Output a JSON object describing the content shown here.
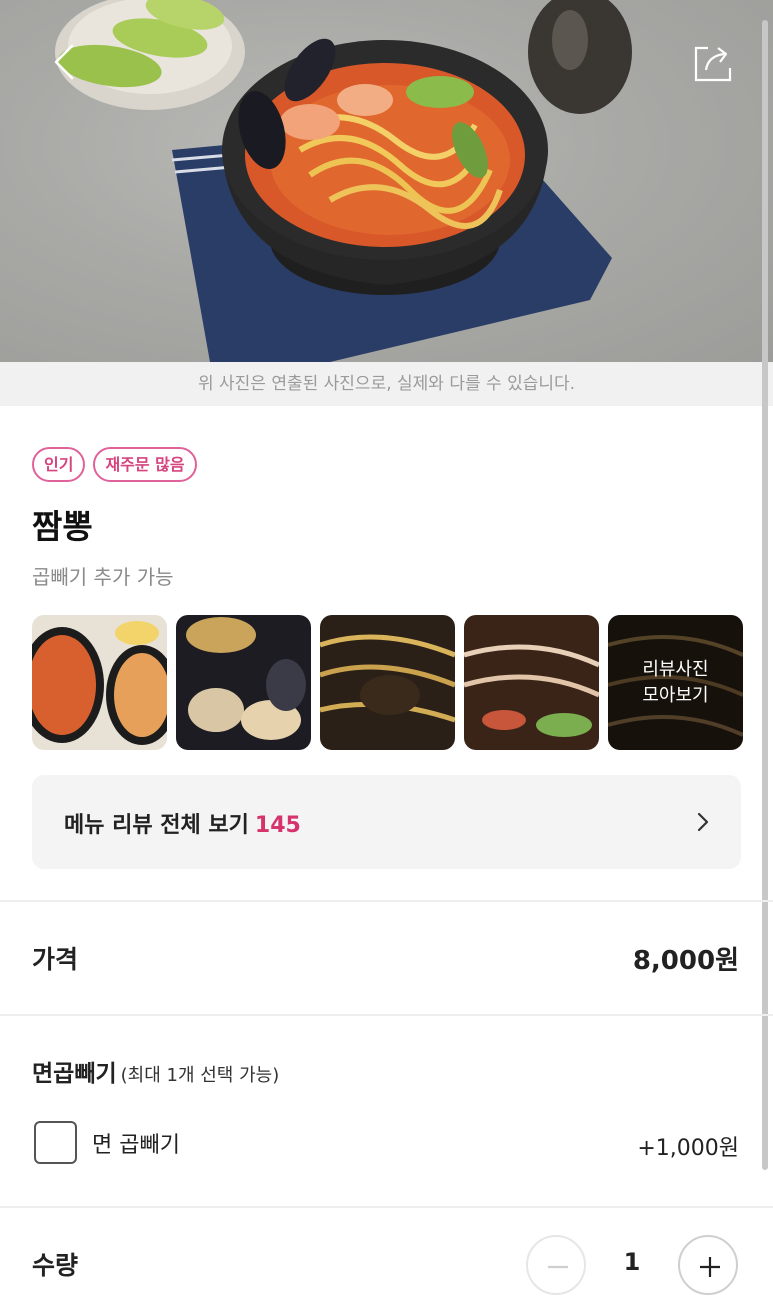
{
  "hero": {
    "disclaimer": "위 사진은 연출된 사진으로, 실제와 다를 수 있습니다.",
    "back_icon": "chevron-left-icon",
    "share_icon": "share-icon"
  },
  "menu": {
    "badges": [
      "인기",
      "재주문 많음"
    ],
    "title": "짬뽕",
    "description": "곱빼기 추가 가능"
  },
  "review_photos": {
    "more_label_line1": "리뷰사진",
    "more_label_line2": "모아보기"
  },
  "reviews": {
    "label": "메뉴 리뷰 전체 보기",
    "count": "145"
  },
  "price": {
    "label": "가격",
    "value": "8,000원"
  },
  "option_group": {
    "title": "면곱빼기",
    "subtitle": "(최대 1개 선택 가능)",
    "options": [
      {
        "name": "면 곱빼기",
        "price": "+1,000원",
        "checked": false
      }
    ]
  },
  "quantity": {
    "label": "수량",
    "value": "1"
  },
  "colors": {
    "accent": "#d6336c",
    "badge_border": "#e0629a"
  }
}
